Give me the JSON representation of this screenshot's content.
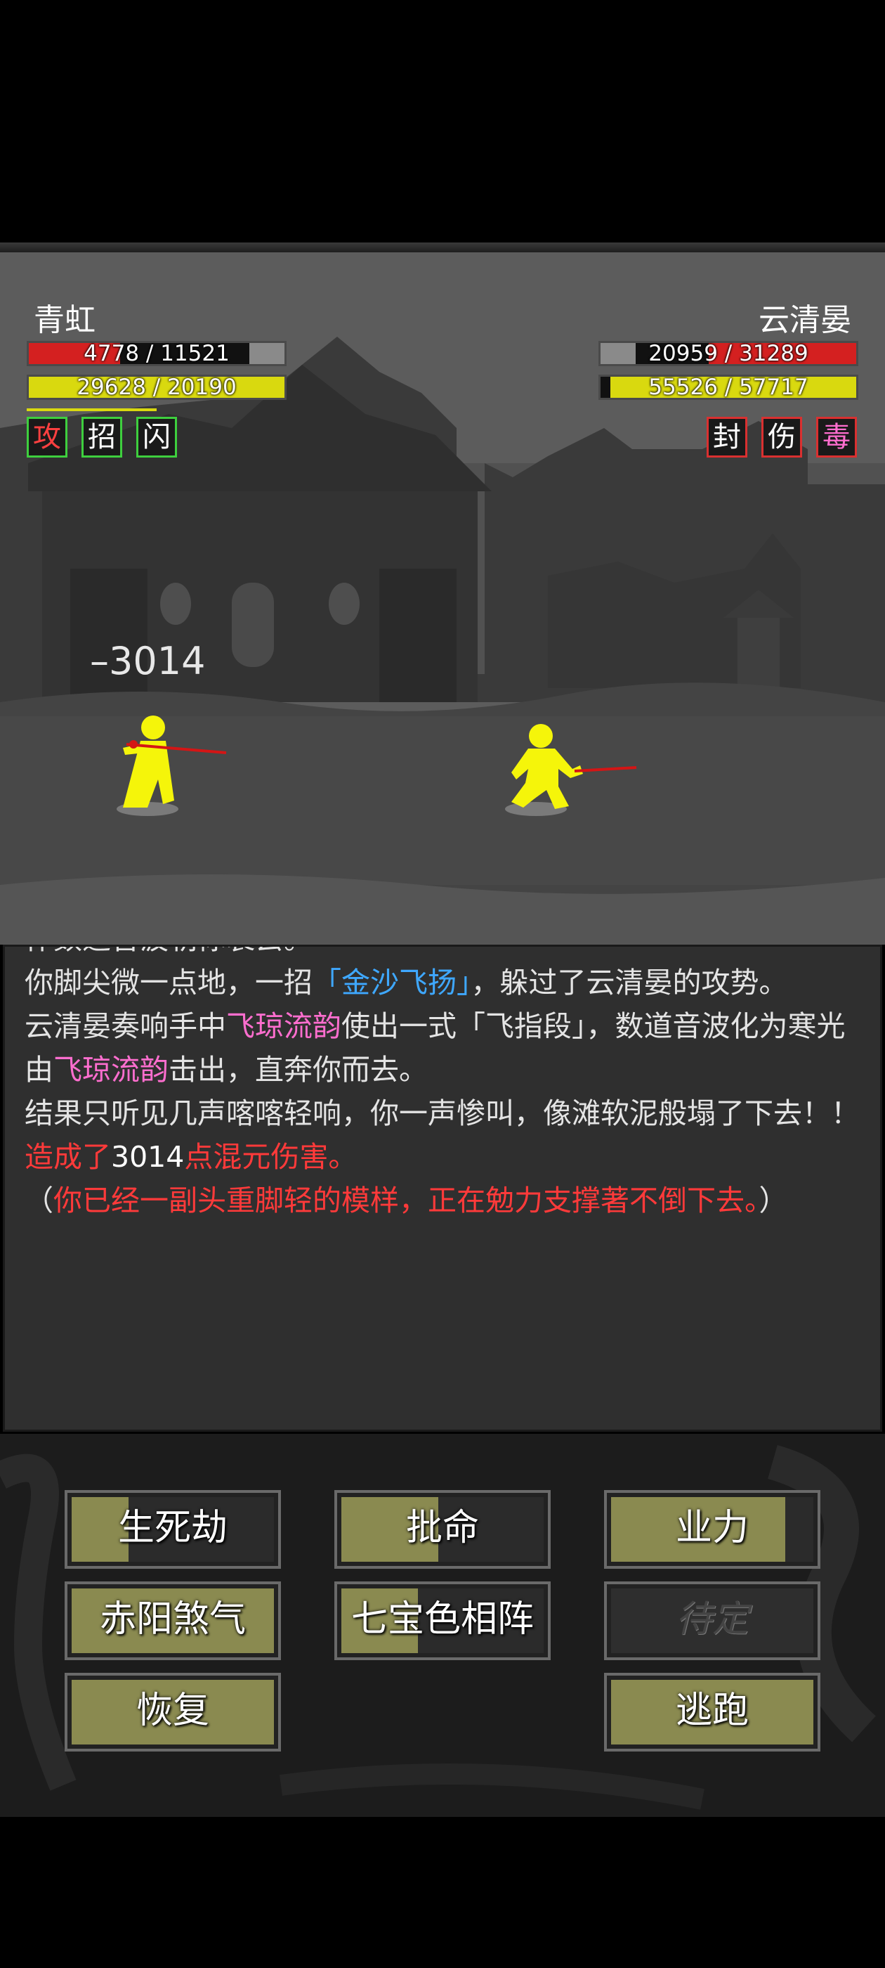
{
  "player": {
    "name": "青虹",
    "hp": "4778 / 11521",
    "hp_ratio": 0.415,
    "mp": "29628 / 20190",
    "mp_ratio": 1.0,
    "statuses": [
      {
        "label": "攻",
        "color": "#3ecf3e",
        "text_color": "#ff4040"
      },
      {
        "label": "招",
        "color": "#3ecf3e",
        "text_color": "#ffffff"
      },
      {
        "label": "闪",
        "color": "#3ecf3e",
        "text_color": "#ffffff"
      }
    ]
  },
  "enemy": {
    "name": "云清晏",
    "hp": "20959 / 31289",
    "hp_ratio": 0.67,
    "mp": "55526 / 57717",
    "mp_ratio": 0.962,
    "statuses": [
      {
        "label": "封",
        "color": "#d93030",
        "text_color": "#ffffff"
      },
      {
        "label": "伤",
        "color": "#d93030",
        "text_color": "#ffffff"
      },
      {
        "label": "毒",
        "color": "#d93030",
        "text_color": "#ff6ecf"
      }
    ]
  },
  "damage_popup": "–3014",
  "log": {
    "line0": "作数道音波朝你袭去。",
    "line1_a": "你脚尖微一点地，一招",
    "line1_b": "「金沙飞扬」",
    "line1_c": "，躲过了云清晏的攻势。",
    "line2_a": "云清晏奏响手中",
    "line2_b": "飞琼流韵",
    "line2_c": "使出一式「飞指段」，数道音波化为寒光由",
    "line2_d": "飞琼流韵",
    "line2_e": "击出，直奔你而去。",
    "line3": "结果只听见几声喀喀轻响，你一声惨叫，像滩软泥般塌了下去！！",
    "line4_a": "造成了",
    "line4_b": "3014",
    "line4_c": "点混元伤害。",
    "line5_a": "（",
    "line5_b": "你已经一副头重脚轻的模样，正在勉力支撑著不倒下去。",
    "line5_c": "）"
  },
  "actions": [
    {
      "label": "生死劫",
      "fill": 0.28,
      "enabled": true
    },
    {
      "label": "批命",
      "fill": 0.48,
      "enabled": true
    },
    {
      "label": "业力",
      "fill": 0.86,
      "enabled": true
    },
    {
      "label": "赤阳煞气",
      "fill": 1.0,
      "enabled": true
    },
    {
      "label": "七宝色相阵",
      "fill": 0.38,
      "enabled": true
    },
    {
      "label": "待定",
      "fill": 0.0,
      "enabled": false
    },
    {
      "label": "恢复",
      "fill": 1.0,
      "enabled": true
    },
    {
      "label": "逃跑",
      "fill": 1.0,
      "enabled": true
    }
  ]
}
